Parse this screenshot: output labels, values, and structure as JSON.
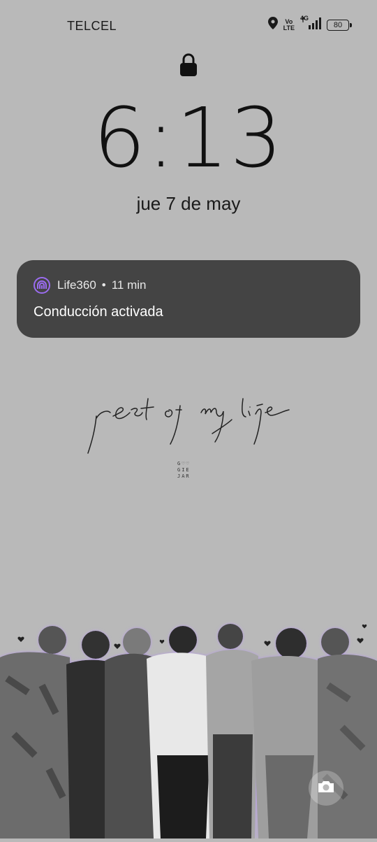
{
  "status_bar": {
    "carrier": "TELCEL",
    "volte_line1": "Vo",
    "volte_line2": "LTE",
    "network": "4G",
    "battery": "80",
    "icons": [
      "location-icon",
      "volte-icon",
      "signal-icon",
      "battery-icon"
    ]
  },
  "lockscreen": {
    "time": "6:13",
    "date": "jue 7 de may"
  },
  "notification": {
    "app": "Life360",
    "separator": "•",
    "age": "11 min",
    "message": "Conducción activada",
    "accent": "#9b6cf0"
  },
  "wallpaper": {
    "handwriting": "rest of my life",
    "brand_lines": [
      "G♡♡",
      "GIE",
      "JAR"
    ],
    "outline_color": "#b79be6"
  },
  "shortcut": {
    "icon": "camera-icon"
  }
}
